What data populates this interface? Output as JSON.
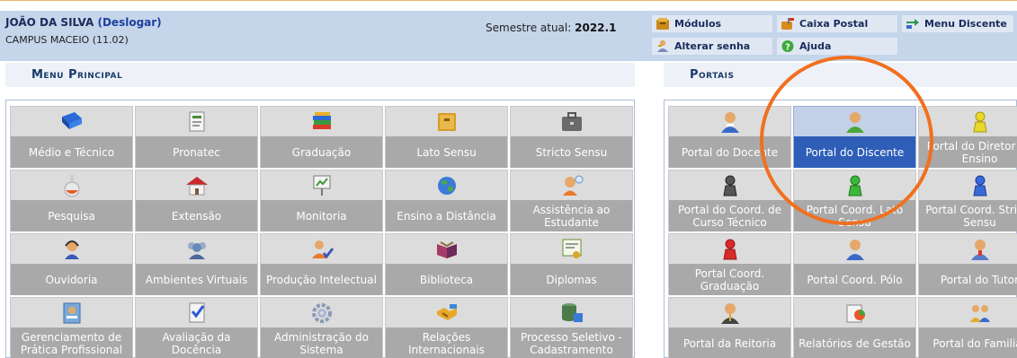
{
  "header": {
    "user_name": "JOÃO DA SILVA",
    "logout_label": "(Deslogar)",
    "campus": "CAMPUS MACEIO (11.02)",
    "semester_label": "Semestre atual:",
    "semester_value": "2022.1"
  },
  "top_links": {
    "modulos": "Módulos",
    "caixa_postal": "Caixa Postal",
    "menu_discente": "Menu Discente",
    "alterar_senha": "Alterar senha",
    "ajuda": "Ajuda"
  },
  "sections": {
    "menu_principal": "Menu Principal",
    "portais": "Portais"
  },
  "menu_items": [
    {
      "label": "Médio e Técnico",
      "icon": "book-icon"
    },
    {
      "label": "Pronatec",
      "icon": "document-icon"
    },
    {
      "label": "Graduação",
      "icon": "books-stack-icon"
    },
    {
      "label": "Lato Sensu",
      "icon": "folder-icon"
    },
    {
      "label": "Stricto Sensu",
      "icon": "briefcase-icon"
    },
    {
      "label": "Pesquisa",
      "icon": "flask-icon"
    },
    {
      "label": "Extensão",
      "icon": "house-icon"
    },
    {
      "label": "Monitoria",
      "icon": "presentation-icon"
    },
    {
      "label": "Ensino a Distância",
      "icon": "globe-icon"
    },
    {
      "label": "Assistência ao Estudante",
      "icon": "help-person-icon"
    },
    {
      "label": "Ouvidoria",
      "icon": "headset-user-icon"
    },
    {
      "label": "Ambientes Virtuais",
      "icon": "users-group-icon"
    },
    {
      "label": "Produção Intelectual",
      "icon": "user-check-icon"
    },
    {
      "label": "Biblioteca",
      "icon": "open-book-icon"
    },
    {
      "label": "Diplomas",
      "icon": "certificate-icon"
    },
    {
      "label": "Gerenciamento de Prática Profissional",
      "icon": "id-card-icon"
    },
    {
      "label": "Avaliação da Docência",
      "icon": "evaluation-form-icon"
    },
    {
      "label": "Administração do Sistema",
      "icon": "gear-icon"
    },
    {
      "label": "Relações Internacionais",
      "icon": "handshake-icon"
    },
    {
      "label": "Processo Seletivo - Cadastramento",
      "icon": "database-icon"
    }
  ],
  "portal_items": [
    {
      "label": "Portal do Docente",
      "icon": "teacher-icon"
    },
    {
      "label": "Portal do Discente",
      "icon": "student-icon",
      "selected": true
    },
    {
      "label": "Portal do Diretor de Ensino",
      "icon": "yellow-pawn-icon"
    },
    {
      "label": "Portal do Coord. de Curso Técnico",
      "icon": "black-pawn-icon"
    },
    {
      "label": "Portal Coord. Lato Sensu",
      "icon": "green-pawn-icon"
    },
    {
      "label": "Portal Coord. Stricto Sensu",
      "icon": "blue-pawn-icon"
    },
    {
      "label": "Portal Coord. Graduação",
      "icon": "red-pawn-icon"
    },
    {
      "label": "Portal Coord. Pólo",
      "icon": "user-icon"
    },
    {
      "label": "Portal do Tutor",
      "icon": "tutor-icon"
    },
    {
      "label": "Portal da Reitoria",
      "icon": "rector-icon"
    },
    {
      "label": "Relatórios de Gestão",
      "icon": "chart-report-icon"
    },
    {
      "label": "Portal do Familiar",
      "icon": "family-icon"
    }
  ]
}
